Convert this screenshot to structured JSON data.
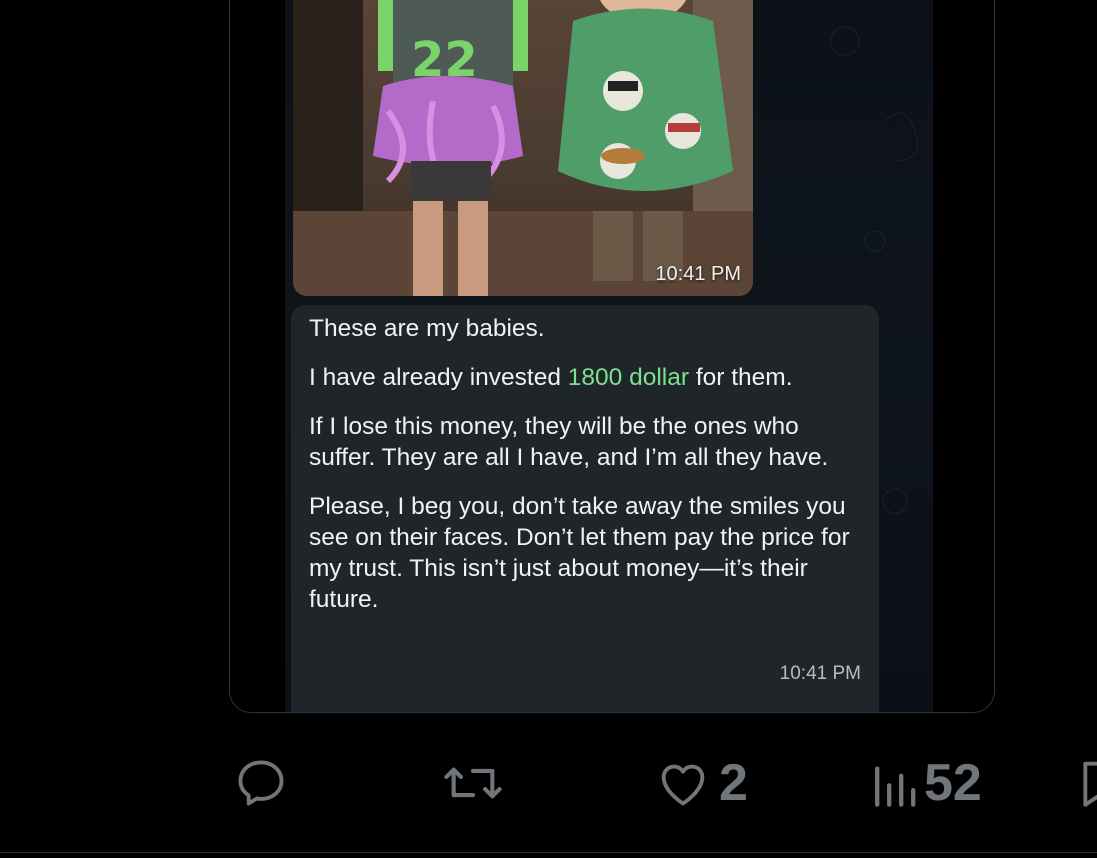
{
  "chat": {
    "photo_time": "10:41 PM",
    "message": {
      "p1": "These are my babies.",
      "p2_before": "I have already invested ",
      "p2_highlight": "1800 dollar",
      "p2_after": " for them.",
      "p3": "If I lose this money, they will be the ones who suffer. They are all I have, and I’m all they have.",
      "p4": "Please, I beg you, don’t take away the smiles you see on their faces. Don’t let them pay the price for my trust. This isn’t just about money—it’s their future.",
      "time": "10:41 PM"
    },
    "highlight_color": "#7ee08f"
  },
  "actions": {
    "reply": {
      "icon": "reply-icon"
    },
    "repost": {
      "icon": "repost-icon"
    },
    "like": {
      "icon": "heart-icon",
      "count": "2"
    },
    "views": {
      "icon": "views-icon",
      "count": "52"
    },
    "bookmark": {
      "icon": "bookmark-icon"
    }
  }
}
